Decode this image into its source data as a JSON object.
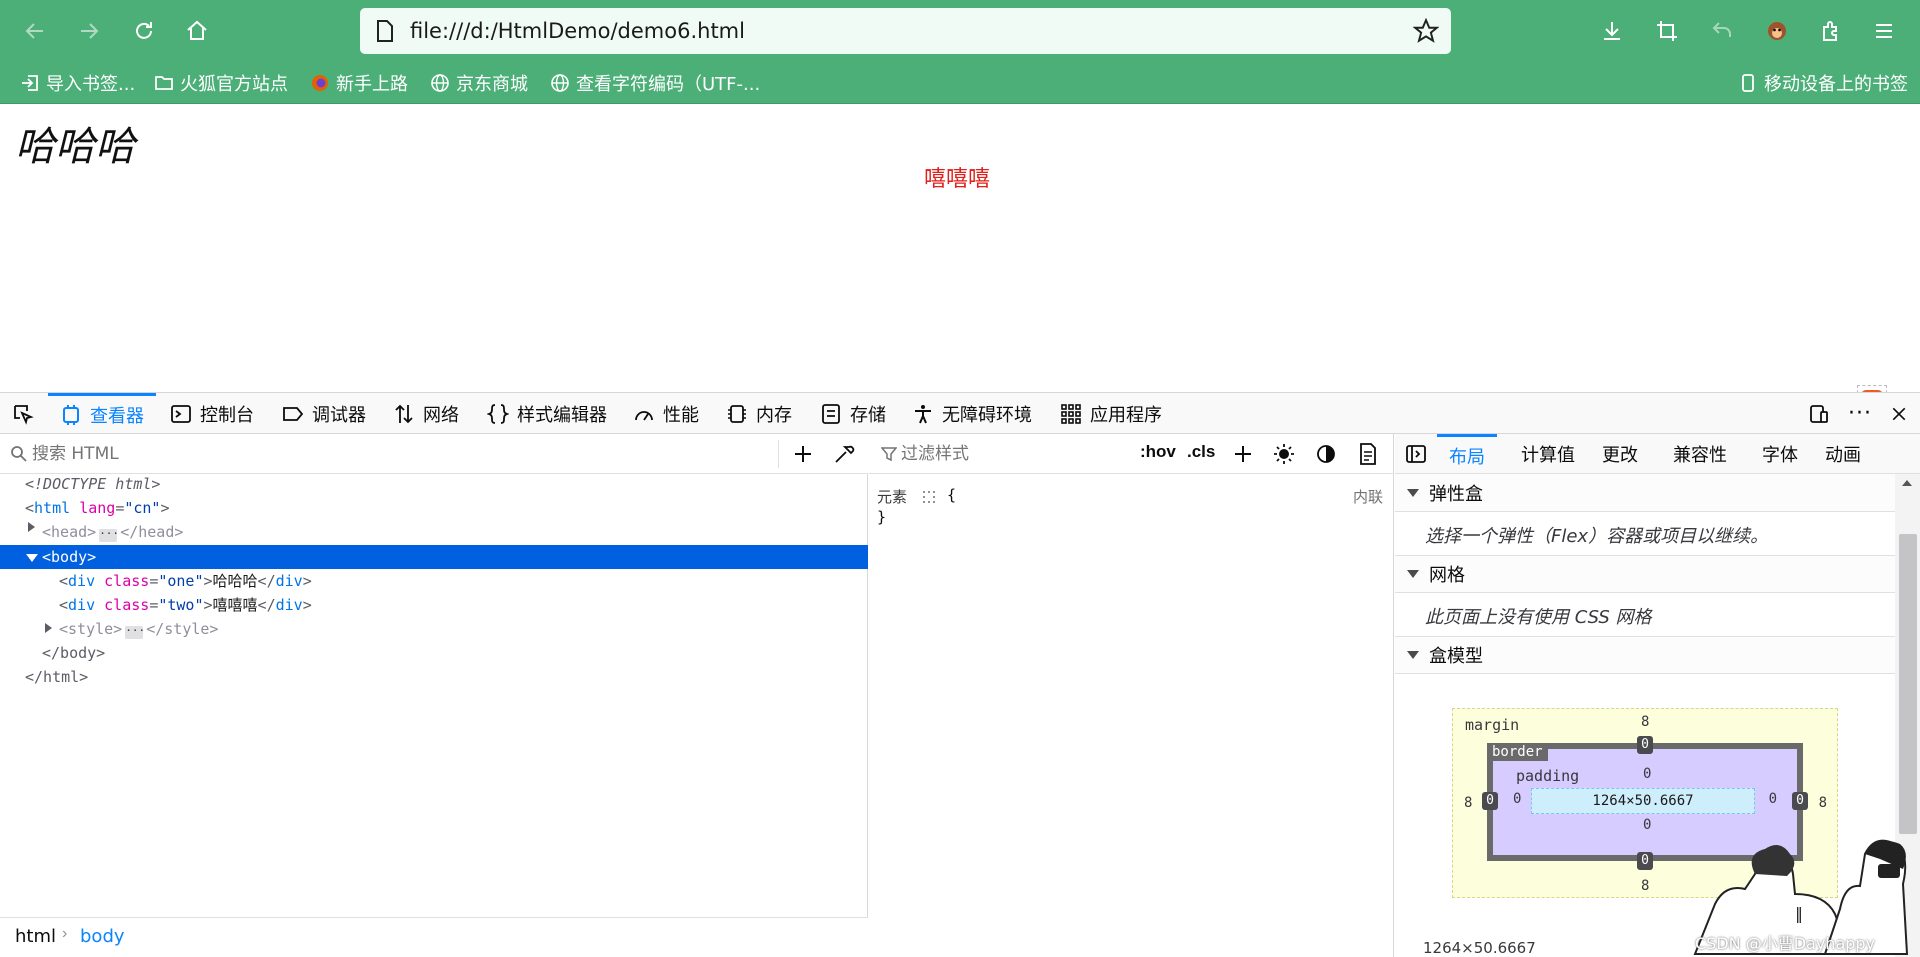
{
  "browser": {
    "url": "file:///d:/HtmlDemo/demo6.html",
    "nav_icons": [
      "back-icon",
      "forward-icon",
      "reload-icon",
      "home-icon"
    ],
    "right_icons": [
      "download-icon",
      "screenshot-icon",
      "undo-icon",
      "extension-monkey-icon",
      "extensions-icon",
      "menu-icon"
    ]
  },
  "bookmarks": [
    {
      "label": "导入书签...",
      "icon": "import-icon"
    },
    {
      "label": "火狐官方站点",
      "icon": "folder-icon"
    },
    {
      "label": "新手上路",
      "icon": "firefox-icon"
    },
    {
      "label": "京东商城",
      "icon": "globe-icon"
    },
    {
      "label": "查看字符编码（UTF-...",
      "icon": "globe-icon"
    }
  ],
  "mobile_bookmarks": "移动设备上的书签",
  "page": {
    "div_one": "哈哈哈",
    "div_two": "嘻嘻嘻",
    "div_two_color": "#e0201a"
  },
  "devtools": {
    "tabs": [
      {
        "label": "查看器",
        "icon": "inspector-icon",
        "active": true
      },
      {
        "label": "控制台",
        "icon": "console-icon"
      },
      {
        "label": "调试器",
        "icon": "debugger-icon"
      },
      {
        "label": "网络",
        "icon": "network-icon"
      },
      {
        "label": "样式编辑器",
        "icon": "style-editor-icon"
      },
      {
        "label": "性能",
        "icon": "performance-icon"
      },
      {
        "label": "内存",
        "icon": "memory-icon"
      },
      {
        "label": "存储",
        "icon": "storage-icon"
      },
      {
        "label": "无障碍环境",
        "icon": "accessibility-icon"
      },
      {
        "label": "应用程序",
        "icon": "application-icon"
      }
    ],
    "search_placeholder": "搜索 HTML",
    "markup": {
      "doctype": "<!DOCTYPE html>",
      "html_open_tag": "html",
      "html_attr_name": "lang",
      "html_attr_value": "\"cn\"",
      "head_open": "<head>",
      "head_close": "</head>",
      "body_open": "<body>",
      "div1_attr_value": "\"one\"",
      "div1_text": "哈哈哈",
      "div2_attr_value": "\"two\"",
      "div2_text": "嘻嘻嘻",
      "style_open": "<style>",
      "style_close": "</style>",
      "body_close": "</body>",
      "html_close": "</html>",
      "class_attr": "class",
      "div_tag": "div"
    },
    "breadcrumbs": [
      "html",
      "body"
    ],
    "rules": {
      "filter_placeholder": "过滤样式",
      "hov": ":hov",
      "cls": ".cls",
      "element_label": "元素",
      "open_brace": "{",
      "close_brace": "}",
      "inline_label": "内联"
    },
    "layout_tabs": [
      "布局",
      "计算值",
      "更改",
      "兼容性",
      "字体",
      "动画"
    ],
    "sections": {
      "flex_title": "弹性盒",
      "flex_body": "选择一个弹性（Flex）容器或项目以继续。",
      "grid_title": "网格",
      "grid_body": "此页面上没有使用 CSS 网格",
      "box_title": "盒模型"
    },
    "box_model": {
      "margin_label": "margin",
      "border_label": "border",
      "padding_label": "padding",
      "margin": {
        "top": "8",
        "right": "8",
        "bottom": "8",
        "left": "8"
      },
      "border": {
        "top": "0",
        "right": "0",
        "bottom": "0",
        "left": "0"
      },
      "padding": {
        "top": "0",
        "right": "0",
        "bottom": "0",
        "left": "0"
      },
      "content": "1264×50.6667",
      "footer_size": "1264×50.6667"
    },
    "watermark": "CSDN @小曹Dayhappy"
  }
}
